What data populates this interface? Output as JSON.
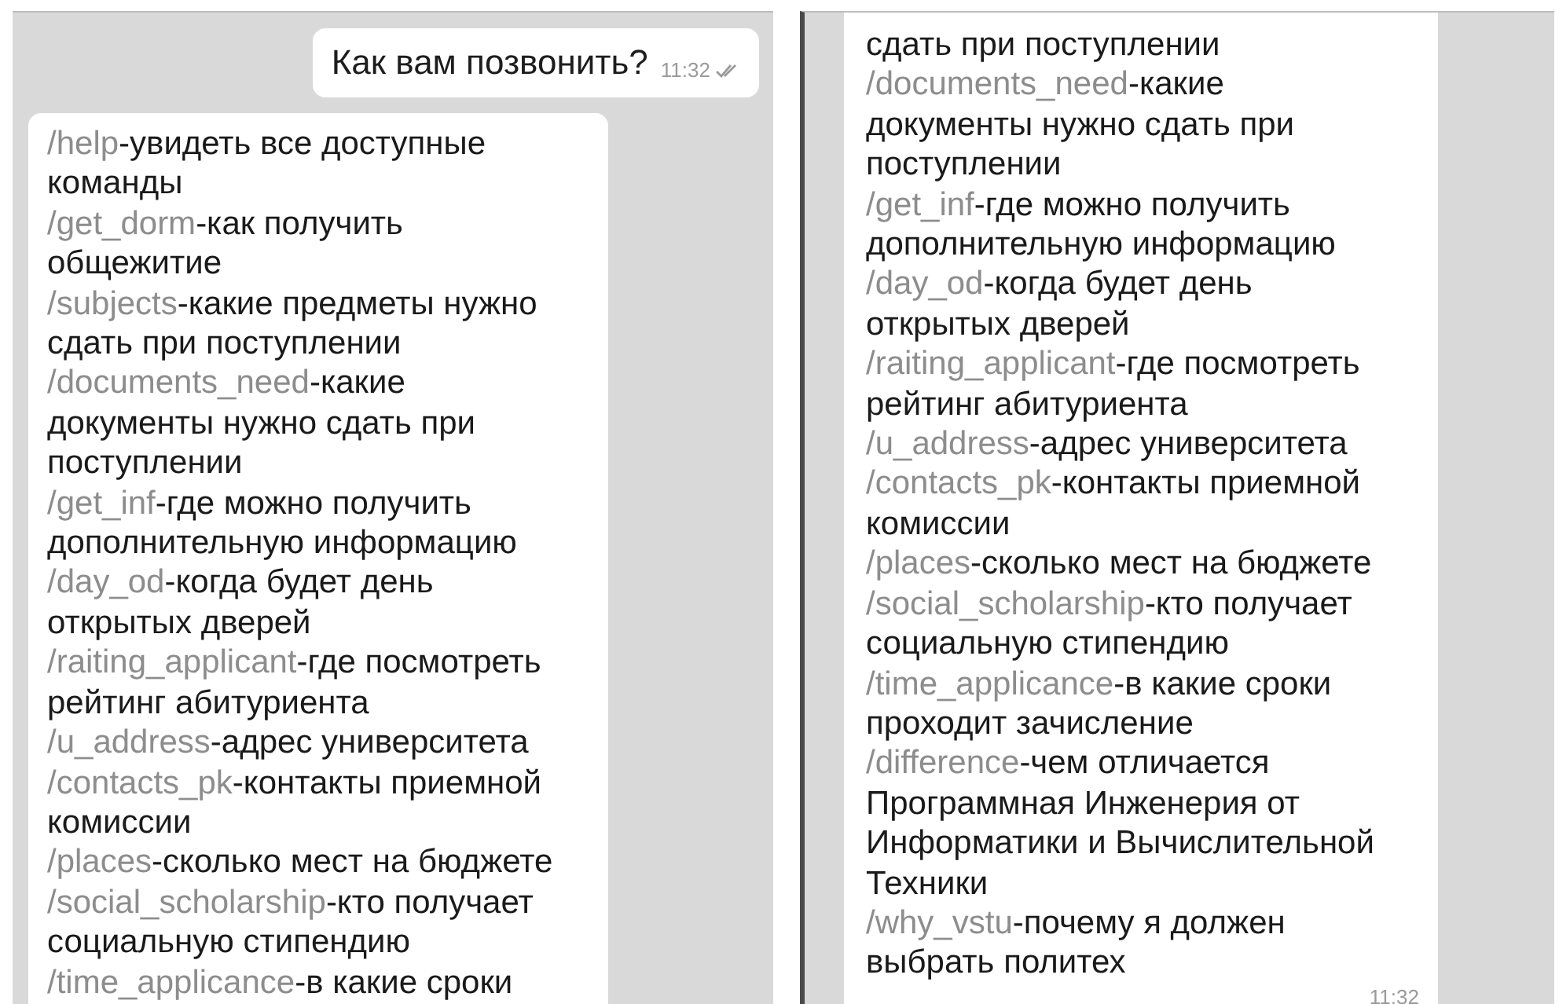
{
  "chats": [
    {
      "messages": [
        {
          "kind": "outgoing",
          "text": "Как вам позвонить?",
          "time": "11:32",
          "read": true
        },
        {
          "kind": "incoming",
          "entries": [
            {
              "command": "/help",
              "description": "-увидеть все доступные\nкоманды"
            },
            {
              "command": "/get_dorm",
              "description": "-как получить\nобщежитие"
            },
            {
              "command": "/subjects",
              "description": "-какие предметы нужно\nсдать при поступлении"
            },
            {
              "command": "/documents_need",
              "description": "-какие\nдокументы нужно сдать при\nпоступлении"
            },
            {
              "command": "/get_inf",
              "description": "-где можно получить\nдополнительную информацию"
            },
            {
              "command": "/day_od",
              "description": "-когда будет день\nоткрытых дверей"
            },
            {
              "command": "/raiting_applicant",
              "description": "-где посмотреть\nрейтинг абитуриента"
            },
            {
              "command": "/u_address",
              "description": "-адрес университета"
            },
            {
              "command": "/contacts_pk",
              "description": "-контакты приемной\nкомиссии"
            },
            {
              "command": "/places",
              "description": "-сколько мест на бюджете"
            },
            {
              "command": "/social_scholarship",
              "description": "-кто получает\nсоциальную стипендию"
            },
            {
              "command": "/time_applicance",
              "description": "-в какие сроки"
            }
          ]
        }
      ]
    },
    {
      "messages": [
        {
          "kind": "incoming",
          "time": "11:32",
          "entries": [
            {
              "description": "сдать при поступлении"
            },
            {
              "command": "/documents_need",
              "description": "-какие\nдокументы нужно сдать при\nпоступлении"
            },
            {
              "command": "/get_inf",
              "description": "-где можно получить\nдополнительную информацию"
            },
            {
              "command": "/day_od",
              "description": "-когда будет день\nоткрытых дверей"
            },
            {
              "command": "/raiting_applicant",
              "description": "-где посмотреть\nрейтинг абитуриента"
            },
            {
              "command": "/u_address",
              "description": "-адрес университета"
            },
            {
              "command": "/contacts_pk",
              "description": "-контакты приемной\nкомиссии"
            },
            {
              "command": "/places",
              "description": "-сколько мест на бюджете"
            },
            {
              "command": "/social_scholarship",
              "description": "-кто получает\nсоциальную стипендию"
            },
            {
              "command": "/time_applicance",
              "description": "-в какие сроки\nпроходит зачисление"
            },
            {
              "command": "/difference",
              "description": "-чем отличается\nПрограммная Инженерия от\nИнформатики и Вычислительной\nТехники"
            },
            {
              "command": "/why_vstu",
              "description": "-почему я должен\nвыбрать политех"
            }
          ]
        }
      ]
    }
  ]
}
